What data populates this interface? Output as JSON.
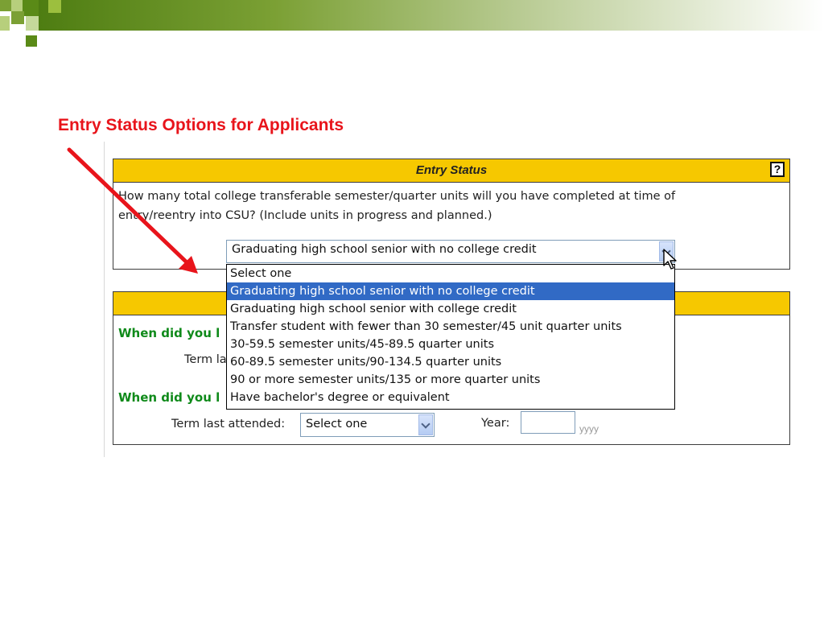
{
  "slide": {
    "title": "Entry Status Options for Applicants"
  },
  "colors": {
    "title_red": "#e8141b",
    "panel_yellow": "#f6c800",
    "question_green": "#0f8a1a",
    "selection_blue": "#316ac5",
    "deco_green": "#4e7d12"
  },
  "entry_panel": {
    "title": "Entry Status",
    "help_label": "?",
    "question_line1": "How many total college transferable semester/quarter units will you have completed at time of",
    "question_line2": "entry/reentry into CSU? (Include units in progress and planned.)",
    "select_value": "Graduating high school senior with no college credit"
  },
  "dropdown": {
    "options": [
      "Select one",
      "Graduating high school senior with no college credit",
      "Graduating high school senior with college credit",
      "Transfer student with fewer than 30 semester/45 unit quarter units",
      "30-59.5 semester units/45-89.5 quarter units",
      "60-89.5 semester units/90-134.5 quarter units",
      "90 or more semester units/135 or more quarter units",
      "Have bachelor's degree or equivalent"
    ],
    "selected_index": 1
  },
  "second_panel": {
    "question1_partial": "When did you l",
    "term_label_partial": "Term la",
    "question2_partial": "When did you l",
    "term_label": "Term last attended:",
    "term_select_value": "Select one",
    "year_label": "Year:",
    "year_value": "",
    "year_hint": "yyyy"
  },
  "icons": [
    "help-icon",
    "dropdown-arrow-icon",
    "mouse-cursor-icon",
    "red-pointer-arrow"
  ]
}
